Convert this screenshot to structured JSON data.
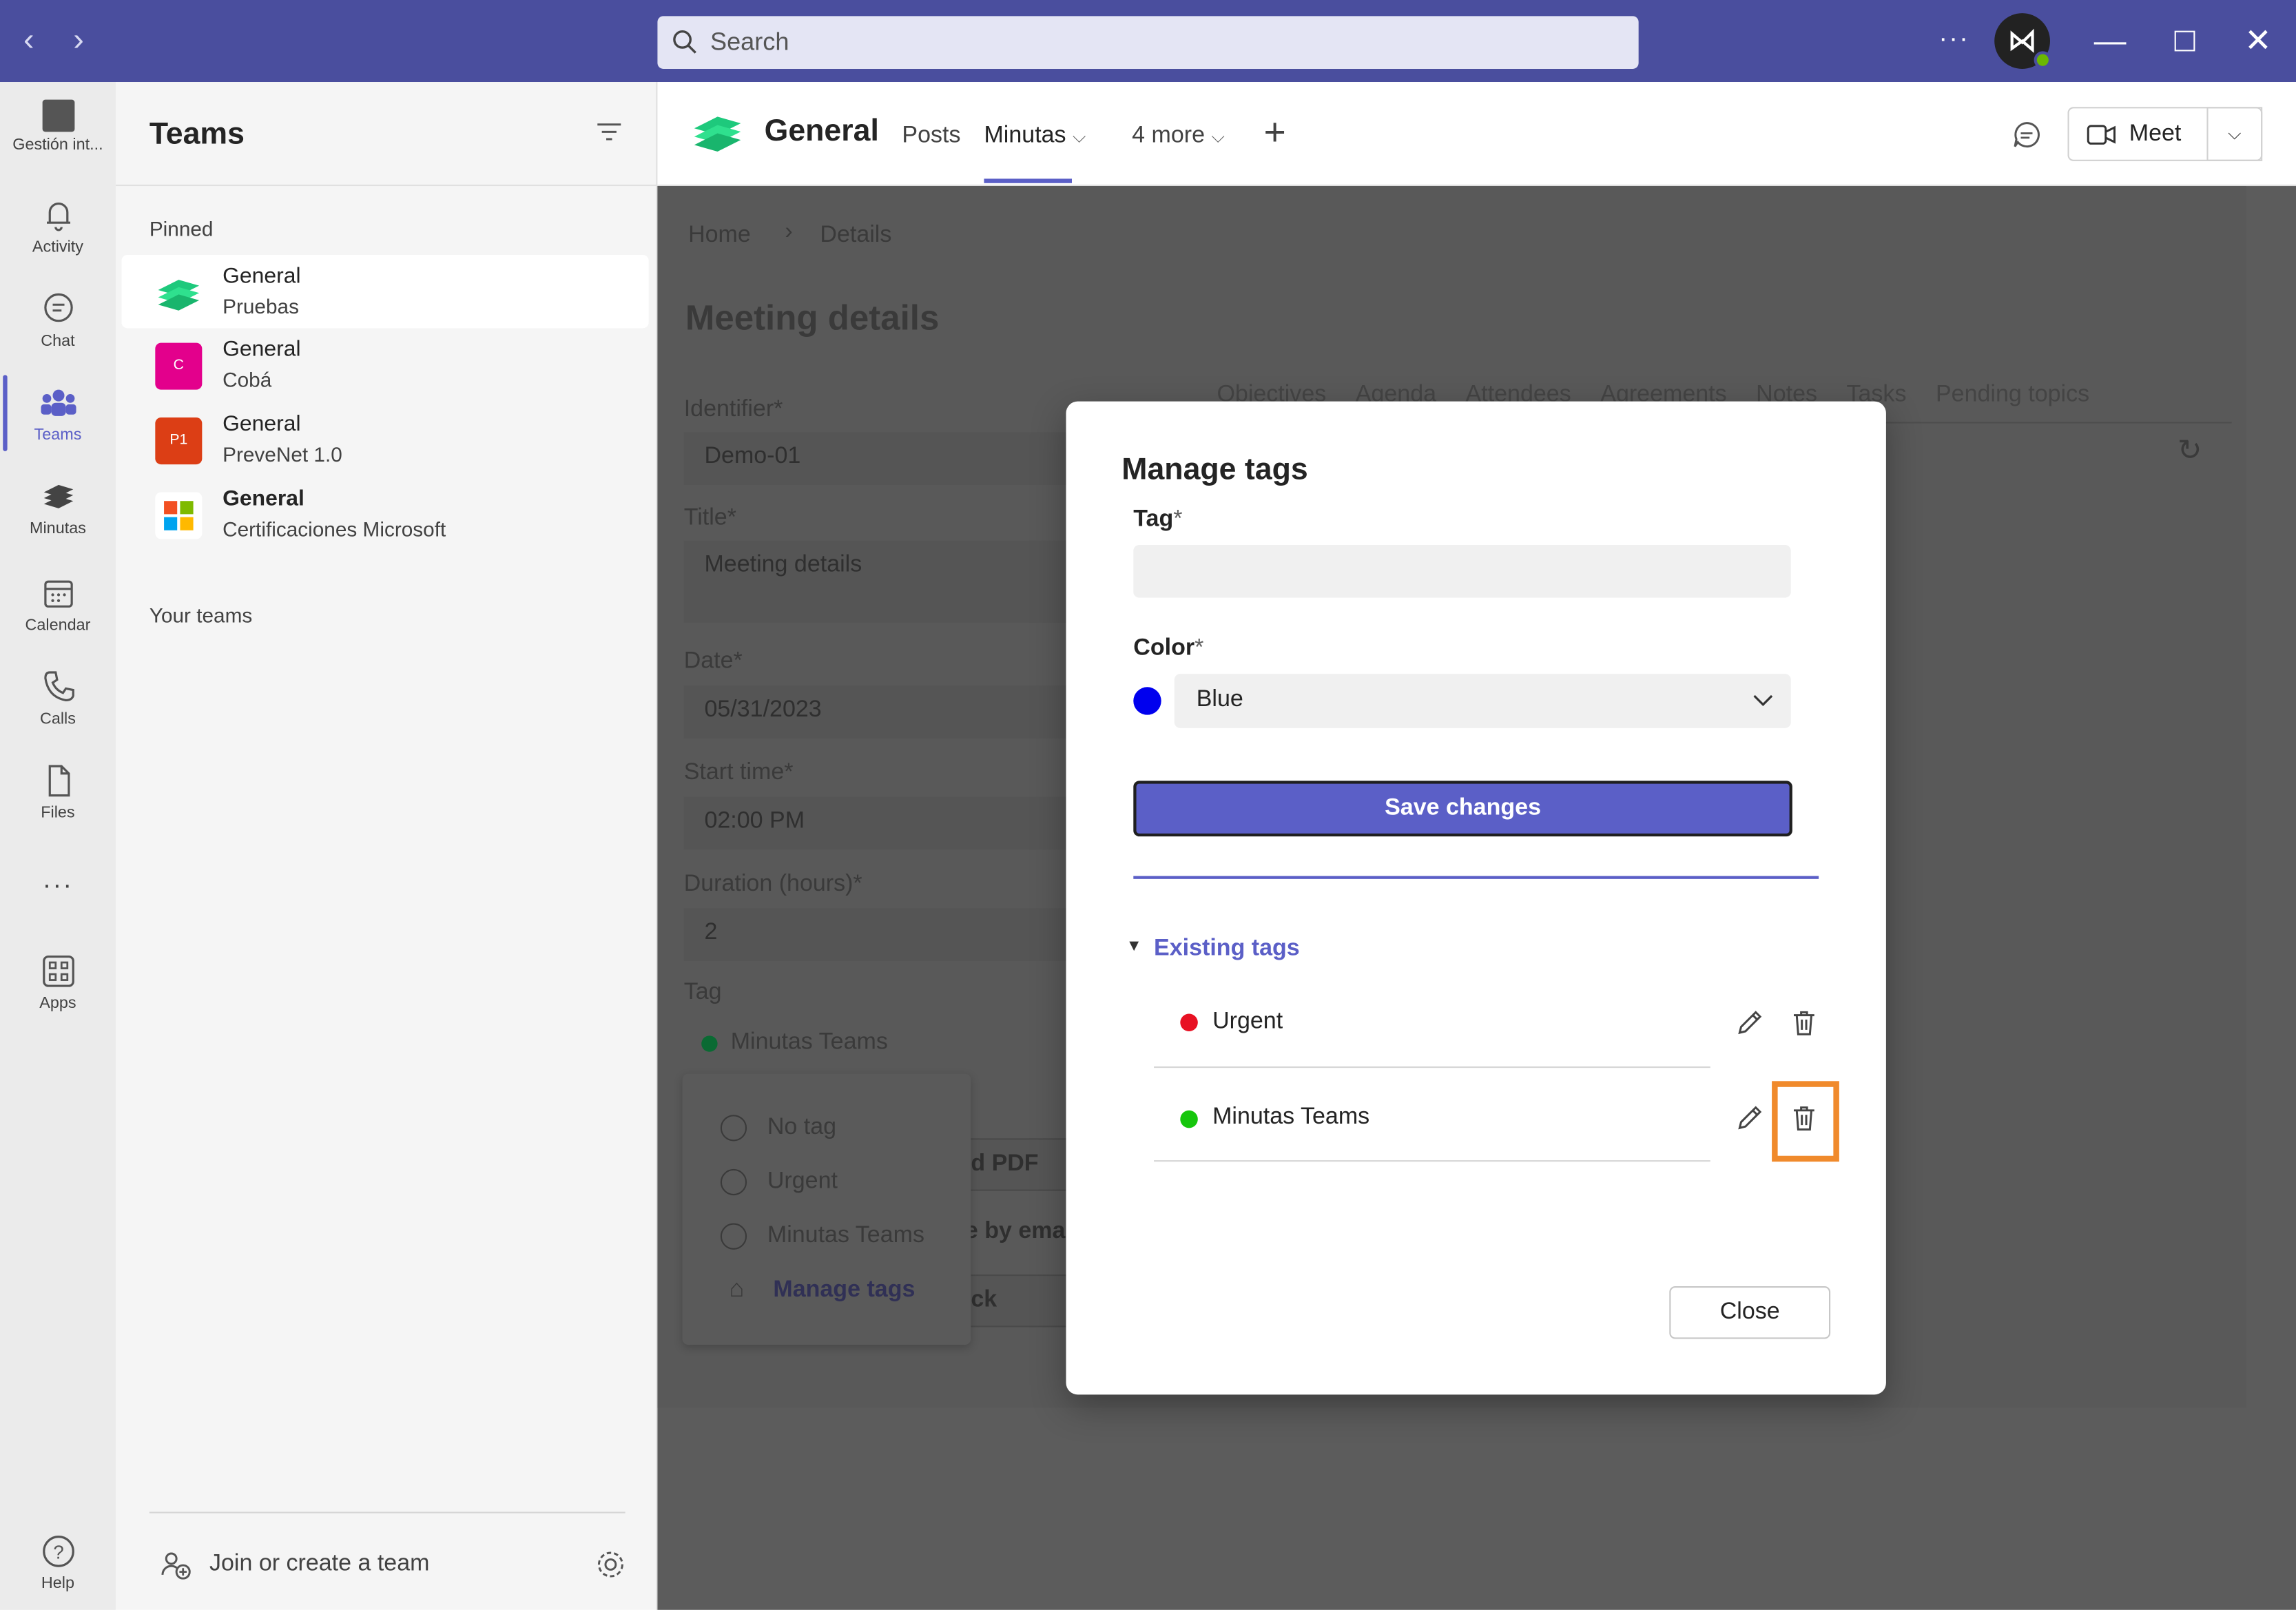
{
  "titlebar": {
    "search_placeholder": "Search",
    "more": "···"
  },
  "rail": {
    "items": [
      {
        "label": "Gestión int...",
        "icon": "app-icon"
      },
      {
        "label": "Activity",
        "icon": "bell-icon"
      },
      {
        "label": "Chat",
        "icon": "chat-icon"
      },
      {
        "label": "Teams",
        "icon": "teams-icon"
      },
      {
        "label": "Minutas",
        "icon": "minutas-icon"
      },
      {
        "label": "Calendar",
        "icon": "calendar-icon"
      },
      {
        "label": "Calls",
        "icon": "phone-icon"
      },
      {
        "label": "Files",
        "icon": "file-icon"
      },
      {
        "label": "Apps",
        "icon": "apps-icon"
      },
      {
        "label": "Help",
        "icon": "help-icon"
      }
    ],
    "more": "···"
  },
  "panel": {
    "title": "Teams",
    "pinned_label": "Pinned",
    "pinned": [
      {
        "name": "General",
        "team": "Pruebas",
        "avatar": ""
      },
      {
        "name": "General",
        "team": "Cobá",
        "avatar": "C"
      },
      {
        "name": "General",
        "team": "PreveNet 1.0",
        "avatar": "P1"
      },
      {
        "name": "General",
        "team": "Certificaciones Microsoft",
        "avatar": ""
      }
    ],
    "your_teams_label": "Your teams",
    "join_label": "Join or create a team"
  },
  "channel": {
    "name": "General",
    "tabs": [
      "Posts",
      "Minutas",
      "4 more"
    ],
    "meet_label": "Meet"
  },
  "background_page": {
    "breadcrumb": [
      "Home",
      "Details"
    ],
    "title": "Meeting details",
    "tabs": [
      "Objectives",
      "Agenda",
      "Attendees",
      "Agreements",
      "Notes",
      "Tasks",
      "Pending topics"
    ],
    "fields": [
      {
        "label": "Identifier*",
        "value": "Demo-01"
      },
      {
        "label": "Title*",
        "value": "Meeting  details"
      },
      {
        "label": "Date*",
        "value": "05/31/2023"
      },
      {
        "label": "Start time*",
        "value": "02:00 PM"
      },
      {
        "label": "Duration (hours)*",
        "value": "2"
      }
    ],
    "tag_label": "Tag",
    "tag_value": "Minutas Teams",
    "tag_menu": [
      "No tag",
      "Urgent",
      "Minutas Teams"
    ],
    "manage_tags": "Manage tags",
    "partial_buttons": [
      "d PDF",
      "e by emai",
      "ck"
    ]
  },
  "modal": {
    "title": "Manage tags",
    "tag_label": "Tag",
    "color_label": "Color",
    "required_mark": "*",
    "color_value": "Blue",
    "color_hex": "#0000ee",
    "save_label": "Save changes",
    "existing_label": "Existing tags",
    "tags": [
      {
        "name": "Urgent",
        "color": "#e81123"
      },
      {
        "name": "Minutas Teams",
        "color": "#16c60c"
      }
    ],
    "close_label": "Close",
    "highlight_color": "#f08a2c"
  }
}
